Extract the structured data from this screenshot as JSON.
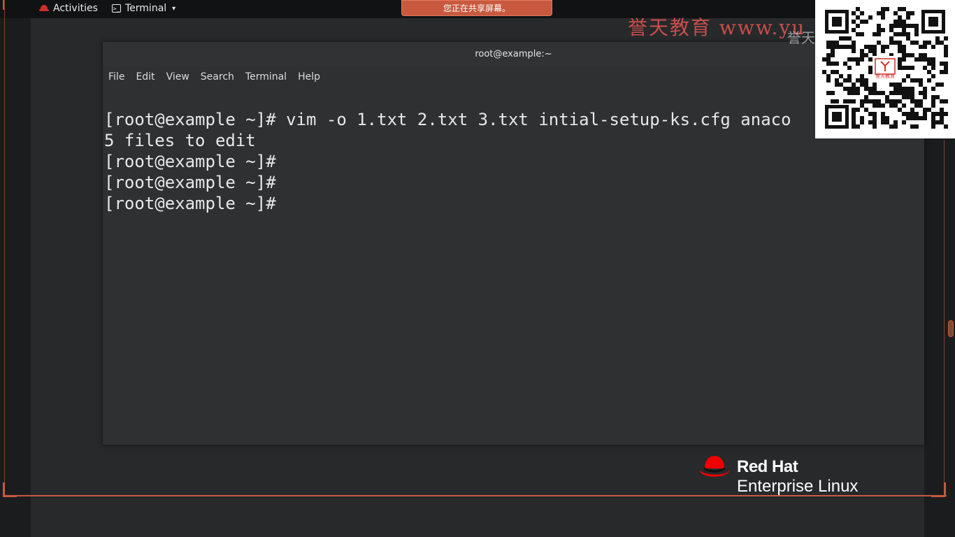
{
  "topbar": {
    "activities_label": "Activities",
    "app_menu_label": "Terminal",
    "terminal_icon_glyph": ">_"
  },
  "share_banner": {
    "text": "您正在共享屏幕。"
  },
  "window": {
    "title": "root@example:~",
    "menu": [
      "File",
      "Edit",
      "View",
      "Search",
      "Terminal",
      "Help"
    ],
    "lines": [
      "[root@example ~]# vim -o 1.txt 2.txt 3.txt intial-setup-ks.cfg anaco",
      "5 files to edit",
      "[root@example ~]#",
      "[root@example ~]#",
      "[root@example ~]#"
    ]
  },
  "watermark": {
    "text": "誉天教育 www.yu",
    "overlay": "誉天"
  },
  "qr": {
    "center_label": "誉天教育"
  },
  "redhat_logo": {
    "brand": "Red Hat",
    "product": "Enterprise Linux",
    "accent": "#ee0000"
  },
  "colors": {
    "share_banner": "#c8593f",
    "frame": "#c8593f",
    "watermark": "#d9534f"
  }
}
